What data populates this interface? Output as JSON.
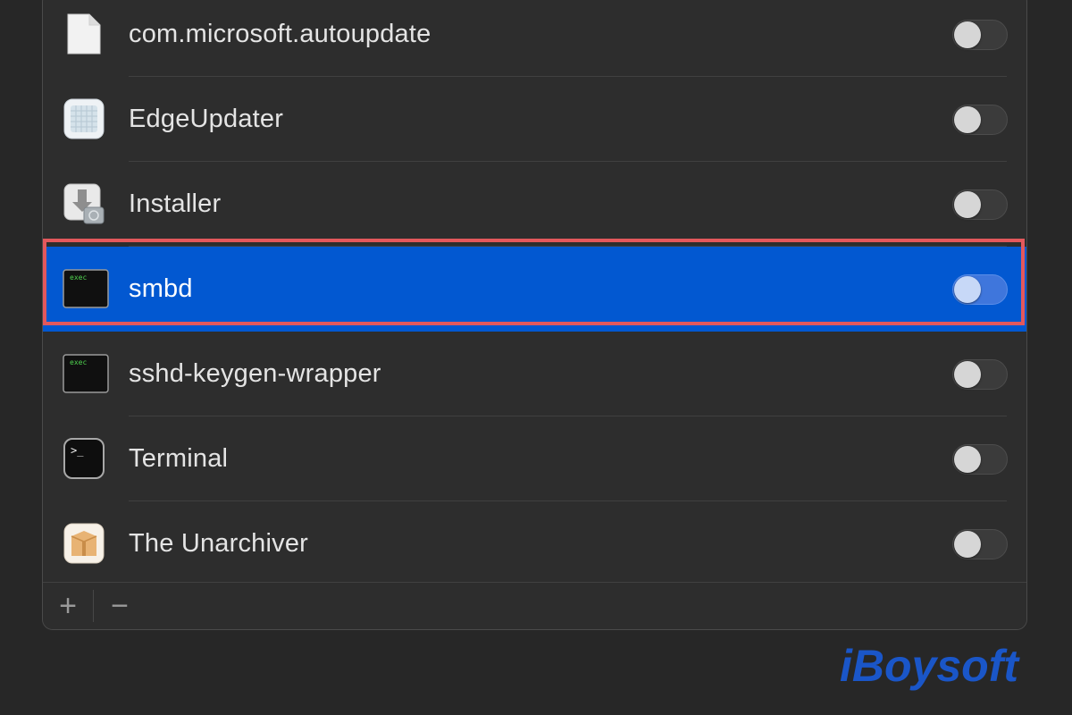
{
  "items": [
    {
      "label": "com.microsoft.autoupdate",
      "icon": "document-icon",
      "enabled": false,
      "selected": false
    },
    {
      "label": "EdgeUpdater",
      "icon": "edge-updater-icon",
      "enabled": false,
      "selected": false
    },
    {
      "label": "Installer",
      "icon": "installer-icon",
      "enabled": false,
      "selected": false
    },
    {
      "label": "smbd",
      "icon": "exec-icon",
      "enabled": false,
      "selected": true
    },
    {
      "label": "sshd-keygen-wrapper",
      "icon": "exec-icon",
      "enabled": false,
      "selected": false
    },
    {
      "label": "Terminal",
      "icon": "terminal-icon",
      "enabled": false,
      "selected": false
    },
    {
      "label": "The Unarchiver",
      "icon": "unarchiver-icon",
      "enabled": false,
      "selected": false
    }
  ],
  "footer": {
    "add_label": "+",
    "remove_label": "−"
  },
  "icon_text": {
    "exec": "exec",
    "terminal": ">_"
  },
  "watermark": {
    "text": "iBoysoft"
  },
  "colors": {
    "selection": "#0258d1",
    "highlight_border": "#e3585c",
    "watermark": "#1a56c8"
  }
}
